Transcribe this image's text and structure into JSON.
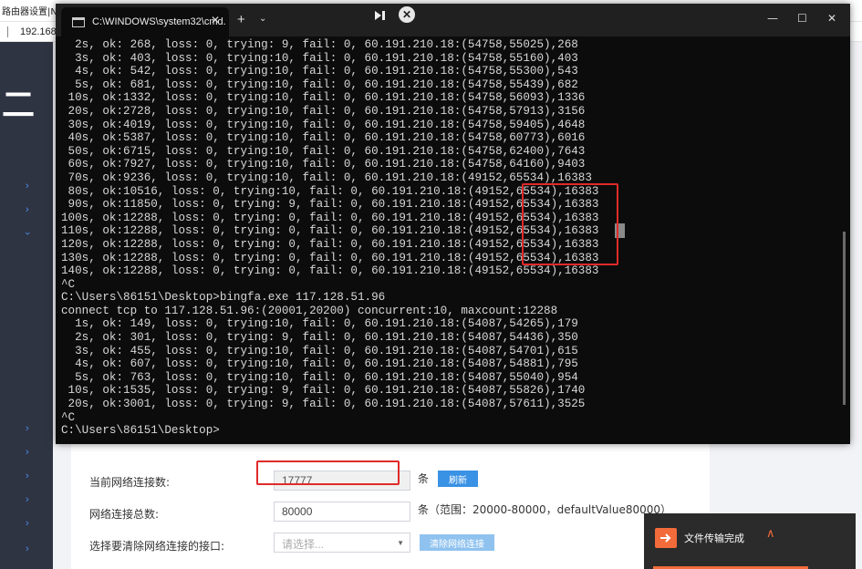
{
  "background_browser": {
    "tab_text": "路由器设置|NAT配",
    "address": "192.168"
  },
  "sidebar": {
    "big_glyph": "二",
    "chevrons": [
      "›",
      "›",
      "›",
      "›",
      "›",
      "›",
      "›",
      "›",
      "›"
    ]
  },
  "form": {
    "current_conn_label": "当前网络连接数:",
    "current_conn_value": "17777",
    "current_conn_unit": "条",
    "refresh_label": "刷新",
    "total_conn_label": "网络连接总数:",
    "total_conn_value": "80000",
    "total_conn_unit": "条（范围：20000-80000，defaultValue80000）",
    "clear_iface_label": "选择要清除网络连接的接口:",
    "clear_iface_placeholder": "请选择...",
    "clear_button_label": "清除网络连接"
  },
  "toast": {
    "text": "文件传输完成",
    "chevron": "∧"
  },
  "cmd": {
    "tab_title": "C:\\WINDOWS\\system32\\cmd.",
    "tab_close": "✕",
    "new_tab": "+",
    "dropdown": "⌄",
    "minimize": "—",
    "maximize": "☐",
    "close": "✕",
    "lines": [
      "  2s, ok: 268, loss: 0, trying: 9, fail: 0, 60.191.210.18:(54758,55025),268",
      "  3s, ok: 403, loss: 0, trying:10, fail: 0, 60.191.210.18:(54758,55160),403",
      "  4s, ok: 542, loss: 0, trying:10, fail: 0, 60.191.210.18:(54758,55300),543",
      "  5s, ok: 681, loss: 0, trying:10, fail: 0, 60.191.210.18:(54758,55439),682",
      " 10s, ok:1332, loss: 0, trying:10, fail: 0, 60.191.210.18:(54758,56093),1336",
      " 20s, ok:2728, loss: 0, trying:10, fail: 0, 60.191.210.18:(54758,57913),3156",
      " 30s, ok:4019, loss: 0, trying:10, fail: 0, 60.191.210.18:(54758,59405),4648",
      " 40s, ok:5387, loss: 0, trying:10, fail: 0, 60.191.210.18:(54758,60773),6016",
      " 50s, ok:6715, loss: 0, trying:10, fail: 0, 60.191.210.18:(54758,62400),7643",
      " 60s, ok:7927, loss: 0, trying:10, fail: 0, 60.191.210.18:(54758,64160),9403",
      " 70s, ok:9236, loss: 0, trying:10, fail: 0, 60.191.210.18:(49152,65534),16383",
      " 80s, ok:10516, loss: 0, trying:10, fail: 0, 60.191.210.18:(49152,65534),16383",
      " 90s, ok:11850, loss: 0, trying: 9, fail: 0, 60.191.210.18:(49152,65534),16383",
      "100s, ok:12288, loss: 0, trying: 0, fail: 0, 60.191.210.18:(49152,65534),16383",
      "110s, ok:12288, loss: 0, trying: 0, fail: 0, 60.191.210.18:(49152,65534),16383",
      "120s, ok:12288, loss: 0, trying: 0, fail: 0, 60.191.210.18:(49152,65534),16383",
      "130s, ok:12288, loss: 0, trying: 0, fail: 0, 60.191.210.18:(49152,65534),16383",
      "140s, ok:12288, loss: 0, trying: 0, fail: 0, 60.191.210.18:(49152,65534),16383",
      "^C",
      "C:\\Users\\86151\\Desktop>bingfa.exe 117.128.51.96",
      "connect tcp to 117.128.51.96:(20001,20200) concurrent:10, maxcount:12288",
      "  1s, ok: 149, loss: 0, trying:10, fail: 0, 60.191.210.18:(54087,54265),179",
      "  2s, ok: 301, loss: 0, trying: 9, fail: 0, 60.191.210.18:(54087,54436),350",
      "  3s, ok: 455, loss: 0, trying:10, fail: 0, 60.191.210.18:(54087,54701),615",
      "  4s, ok: 607, loss: 0, trying:10, fail: 0, 60.191.210.18:(54087,54881),795",
      "  5s, ok: 763, loss: 0, trying:10, fail: 0, 60.191.210.18:(54087,55040),954",
      " 10s, ok:1535, loss: 0, trying: 9, fail: 0, 60.191.210.18:(54087,55826),1740",
      " 20s, ok:3001, loss: 0, trying: 9, fail: 0, 60.191.210.18:(54087,57611),3525",
      "^C",
      "C:\\Users\\86151\\Desktop>"
    ]
  },
  "capture_toolbar": {
    "pin_icon": "pin-icon",
    "close_icon": "close-circle-icon",
    "close_glyph": "✕"
  },
  "colors": {
    "highlight_red": "#e02a2a",
    "button_blue": "#3a92e5",
    "toast_accent": "#f26b3a",
    "sidebar_bg": "#2f3443",
    "terminal_bg": "#0c0c0c"
  }
}
